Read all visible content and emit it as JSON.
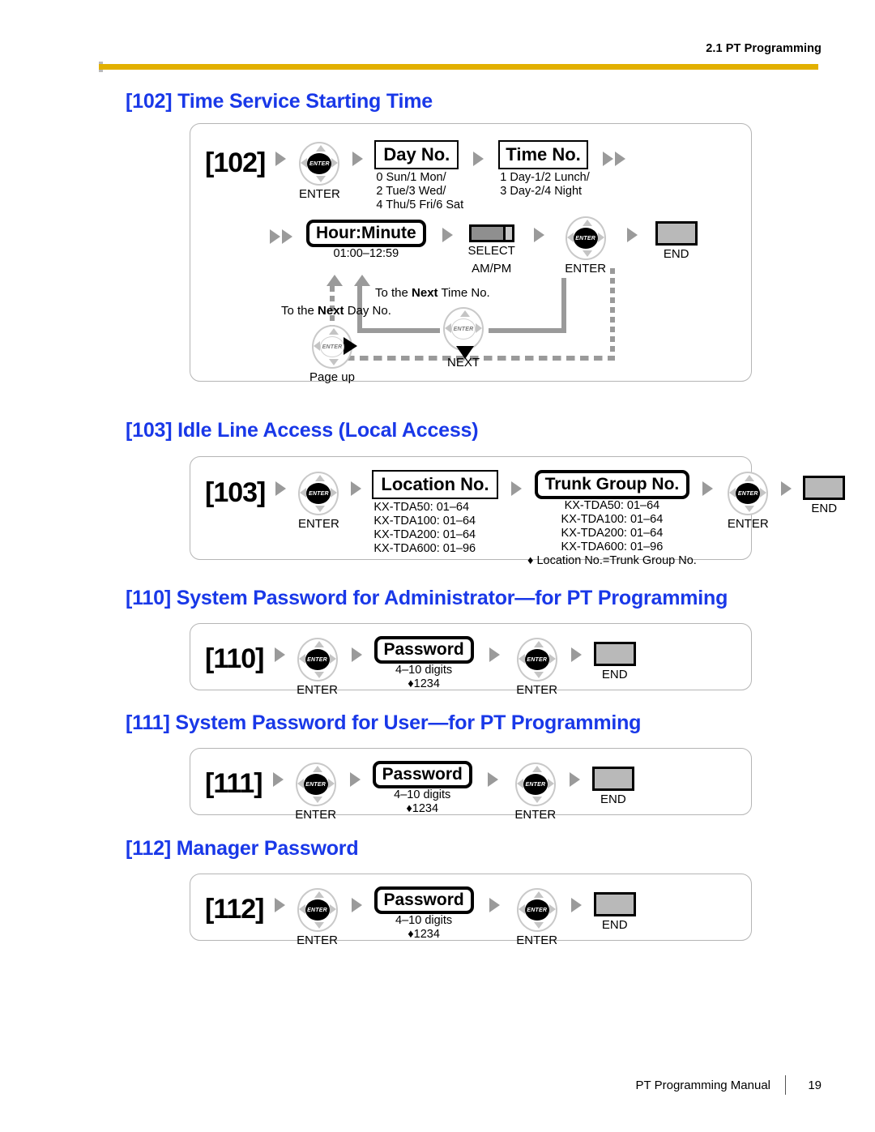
{
  "header": {
    "label": "2.1 PT Programming",
    "rule_color": "#E2B000"
  },
  "theme": {
    "heading_color": "#1938E8",
    "frame_border": "#b5b5b5",
    "arrow_gray": "#9a9a9a"
  },
  "footer": {
    "manual": "PT Programming Manual",
    "page": "19"
  },
  "sections": [
    {
      "title": "[102] Time Service Starting Time",
      "code": "[102]",
      "row1": {
        "enter_caption": "ENTER",
        "day_box": "Day No.",
        "day_note": "0 Sun/1 Mon/\n2 Tue/3 Wed/\n4 Thu/5 Fri/6 Sat",
        "day_note_l1": "0 Sun/1 Mon/",
        "day_note_l2": "2 Tue/3 Wed/",
        "day_note_l3": "4 Thu/5 Fri/6 Sat",
        "time_box": "Time No.",
        "time_note_l1": "1 Day-1/2 Lunch/",
        "time_note_l2": "3 Day-2/4 Night"
      },
      "row2": {
        "hour_box": "Hour:Minute",
        "hour_note": "01:00–12:59",
        "select_caption": "SELECT",
        "select_sub": "AM/PM",
        "enter_caption": "ENTER",
        "end_caption": "END"
      },
      "loop": {
        "next_day_pre": "To the ",
        "next_day_bold": "Next",
        "next_day_post": " Day No.",
        "next_time_pre": "To the ",
        "next_time_bold": "Next",
        "next_time_post": " Time No.",
        "pageup_caption": "Page up",
        "next_caption": "NEXT"
      }
    },
    {
      "title": "[103] Idle Line Access (Local Access)",
      "code": "[103]",
      "enter_caption": "ENTER",
      "location_box": "Location No.",
      "location_notes": [
        "KX-TDA50: 01–64",
        "KX-TDA100: 01–64",
        "KX-TDA200: 01–64",
        "KX-TDA600: 01–96"
      ],
      "trunk_box": "Trunk Group No.",
      "trunk_notes": [
        "KX-TDA50: 01–64",
        "KX-TDA100: 01–64",
        "KX-TDA200: 01–64",
        "KX-TDA600: 01–96"
      ],
      "default_note": "♦ Location No.=Trunk Group No.",
      "enter_caption2": "ENTER",
      "end_caption": "END"
    },
    {
      "title": "[110] System Password for Administrator—for PT Programming",
      "code": "[110]",
      "enter_caption": "ENTER",
      "password_box": "Password",
      "digits_note": "4–10 digits",
      "default_note": "♦1234",
      "enter_caption2": "ENTER",
      "end_caption": "END"
    },
    {
      "title": "[111] System Password for User—for PT Programming",
      "code": "[111]",
      "enter_caption": "ENTER",
      "password_box": "Password",
      "digits_note": "4–10 digits",
      "default_note": "♦1234",
      "enter_caption2": "ENTER",
      "end_caption": "END"
    },
    {
      "title": "[112] Manager Password",
      "code": "[112]",
      "enter_caption": "ENTER",
      "password_box": "Password",
      "digits_note": "4–10 digits",
      "default_note": "♦1234",
      "enter_caption2": "ENTER",
      "end_caption": "END"
    }
  ],
  "icons": {
    "navigator": "navigator-enter-icon",
    "select": "select-button-icon",
    "end": "end-button-icon",
    "arrow": "flow-arrow-icon"
  }
}
